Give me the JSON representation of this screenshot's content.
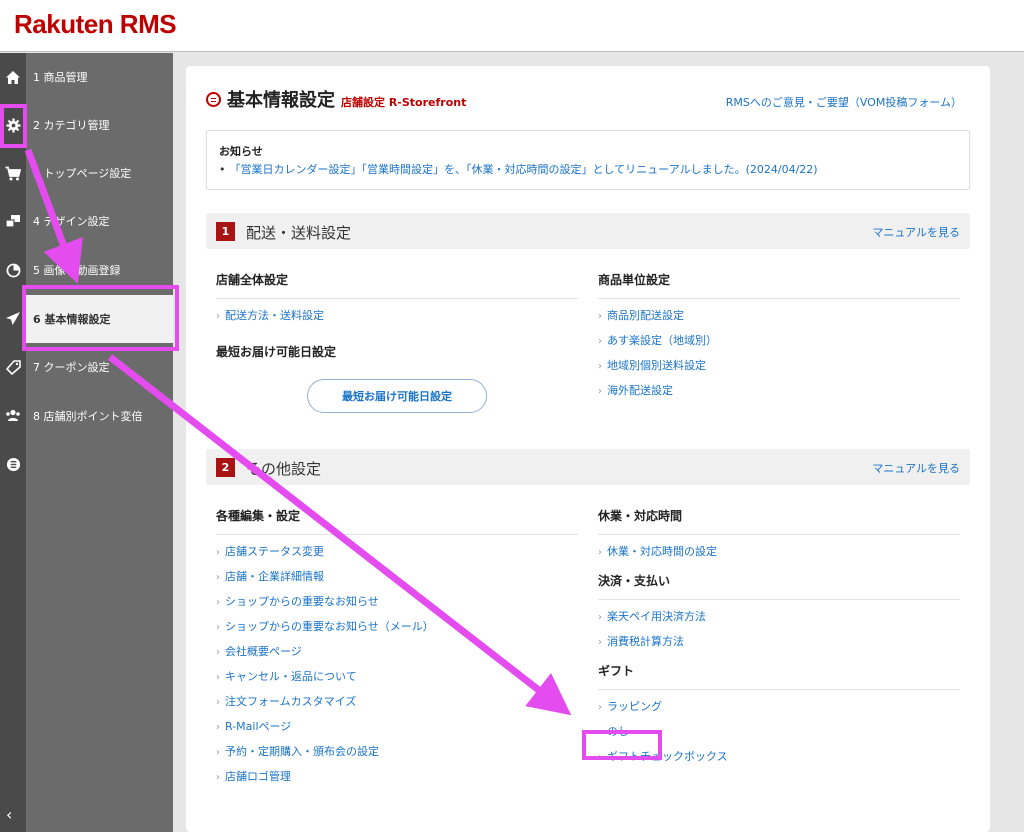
{
  "brand": {
    "logo": "Rakuten RMS"
  },
  "rail": {
    "icons": [
      "home-icon",
      "gear-icon",
      "cart-icon",
      "design-icon",
      "pie-chart-icon",
      "paper-plane-icon",
      "coupon-icon",
      "people-icon",
      "list-icon"
    ],
    "collapse_glyph": "‹"
  },
  "nav": {
    "items": [
      {
        "label": "1 商品管理"
      },
      {
        "label": "2 カテゴリ管理"
      },
      {
        "label": "3 トップページ設定"
      },
      {
        "label": "4 デザイン設定"
      },
      {
        "label": "5 画像・動画登録"
      },
      {
        "label": "6 基本情報設定"
      },
      {
        "label": "7 クーポン設定"
      },
      {
        "label": "8 店舗別ポイント変倍"
      }
    ]
  },
  "page": {
    "title": "基本情報設定",
    "breadcrumb": "店舗設定 R-Storefront",
    "feedback_link": "RMSへのご意見・ご要望（VOM投稿フォーム）"
  },
  "notice": {
    "title": "お知らせ",
    "items": [
      "「営業日カレンダー設定」「営業時間設定」を、「休業・対応時間の設定」としてリニューアルしました。(2024/04/22)"
    ]
  },
  "sections": [
    {
      "number": "1",
      "title": "配送・送料設定",
      "manual": "マニュアルを見る",
      "left": {
        "heading": "店舗全体設定",
        "links": [
          "配送方法・送料設定"
        ],
        "sub_heading": "最短お届け可能日設定",
        "button": "最短お届け可能日設定"
      },
      "right": {
        "heading": "商品単位設定",
        "links": [
          "商品別配送設定",
          "あす楽設定（地域別）",
          "地域別個別送料設定",
          "海外配送設定"
        ]
      }
    },
    {
      "number": "2",
      "title": "その他設定",
      "manual": "マニュアルを見る",
      "left": {
        "heading": "各種編集・設定",
        "links": [
          "店舗ステータス変更",
          "店舗・企業詳細情報",
          "ショップからの重要なお知らせ",
          "ショップからの重要なお知らせ（メール）",
          "会社概要ページ",
          "キャンセル・返品について",
          "注文フォームカスタマイズ",
          "R-Mailページ",
          "予約・定期購入・頒布会の設定",
          "店舗ロゴ管理"
        ]
      },
      "right": {
        "hours_heading": "休業・対応時間",
        "hours_links": [
          "休業・対応時間の設定"
        ],
        "payment_heading": "決済・支払い",
        "payment_links": [
          "楽天ペイ用決済方法",
          "消費税計算方法"
        ],
        "gift_heading": "ギフト",
        "gift_links": [
          "ラッピング",
          "のし",
          "ギフトチェックボックス"
        ]
      }
    }
  ],
  "annotation": {
    "color": "#e44cf0"
  }
}
